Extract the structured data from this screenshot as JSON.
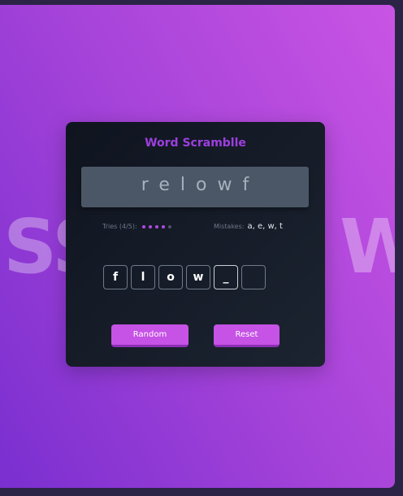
{
  "game": {
    "title": "Word Scramblle",
    "scrambled_word": "relowf",
    "tries_label": "Tries (4/5):",
    "tries_used": 4,
    "tries_max": 5,
    "mistakes_label": "Mistakes:",
    "mistakes_value": "a, e, w, t",
    "input_letters": [
      "f",
      "l",
      "o",
      "w",
      "_",
      ""
    ],
    "random_label": "Random",
    "reset_label": "Reset"
  },
  "background": {
    "left_letters": "SS",
    "right_letter": "W"
  },
  "colors": {
    "accent": "#c652e6",
    "title": "#9d3fe0",
    "dot_active": "#b14ae6",
    "card": "#151b27"
  }
}
